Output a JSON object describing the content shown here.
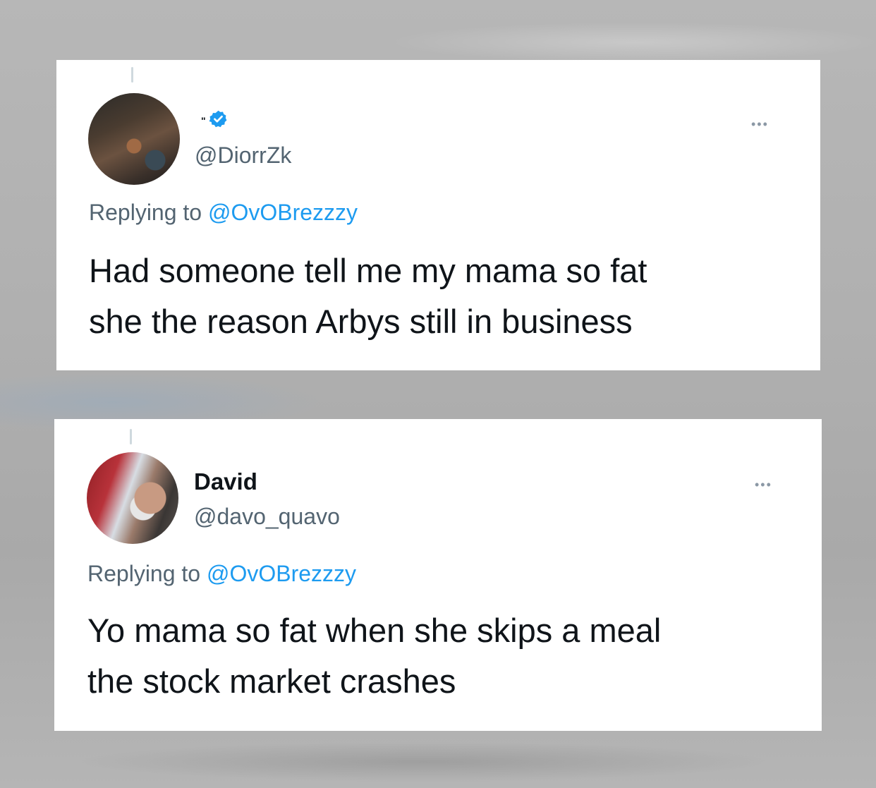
{
  "tweets": [
    {
      "display_name": "",
      "name_mark": "\"",
      "verified": true,
      "handle": "@DiorrZk",
      "more_label": "•••",
      "replying_prefix": "Replying to",
      "replying_to": "@OvOBrezzzy",
      "text_line1": "Had someone tell me my mama so fat",
      "text_line2": "she the reason Arbys still in business"
    },
    {
      "display_name": "David",
      "verified": false,
      "handle": "@davo_quavo",
      "more_label": "•••",
      "replying_prefix": "Replying to",
      "replying_to": "@OvOBrezzzy",
      "text_line1": "Yo mama so fat when she skips a meal",
      "text_line2": "the stock market crashes"
    }
  ],
  "colors": {
    "text": "#0f1419",
    "secondary": "#536471",
    "accent": "#1d9bf0"
  }
}
